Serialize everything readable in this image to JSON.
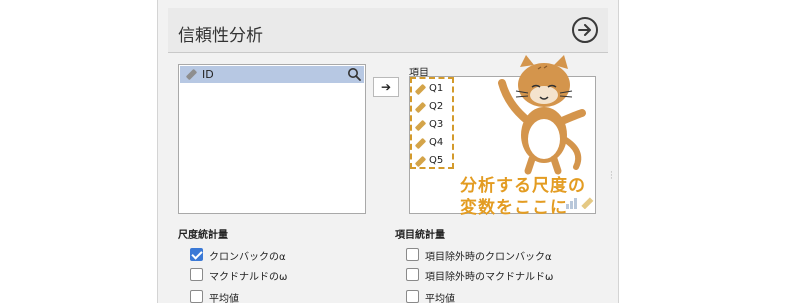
{
  "title": "信頼性分析",
  "variables": [
    {
      "label": "ID"
    }
  ],
  "move_button_glyph": "➔",
  "items_label": "項目",
  "items": [
    "Q1",
    "Q2",
    "Q3",
    "Q4",
    "Q5"
  ],
  "drop_hint": {
    "line1": "分析する尺度の",
    "line2": "変数をここに"
  },
  "scale_stats": {
    "title": "尺度統計量",
    "options": [
      {
        "label": "クロンバックのα",
        "checked": true
      },
      {
        "label": "マクドナルドのω",
        "checked": false
      },
      {
        "label": "平均値",
        "checked": false
      }
    ]
  },
  "item_stats": {
    "title": "項目統計量",
    "options": [
      {
        "label": "項目除外時のクロンバックα",
        "checked": false
      },
      {
        "label": "項目除外時のマクドナルドω",
        "checked": false
      },
      {
        "label": "平均値",
        "checked": false
      }
    ]
  },
  "colors": {
    "accent": "#e39c22",
    "selection": "#b7c8e3",
    "checkbox": "#3b79d6",
    "cat": "#d4954c"
  },
  "icons": [
    "go-arrow-icon",
    "ruler-icon",
    "search-icon",
    "bar-chart-icon",
    "mascot-cat"
  ]
}
